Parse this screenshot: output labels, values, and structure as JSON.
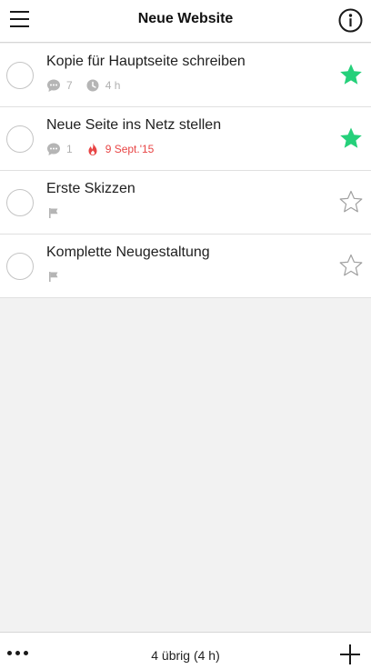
{
  "header": {
    "title": "Neue Website",
    "menu_icon": "hamburger-menu-icon",
    "info_icon": "info-icon"
  },
  "tasks": [
    {
      "title": "Kopie für Hauptseite schreiben",
      "comments": "7",
      "time": "4 h",
      "starred": true
    },
    {
      "title": "Neue Seite ins Netz stellen",
      "comments": "1",
      "due": "9 Sept.'15",
      "starred": true
    },
    {
      "title": "Erste Skizzen",
      "starred": false
    },
    {
      "title": "Komplette Neugestaltung",
      "starred": false
    }
  ],
  "footer": {
    "remaining": "4 übrig (4 h)",
    "more_icon": "more-dots-icon",
    "add_icon": "plus-icon"
  },
  "colors": {
    "star_active": "#25d07a",
    "star_inactive": "#a0a0a0",
    "due_date": "#e84545",
    "meta_gray": "#b0b0b0"
  }
}
